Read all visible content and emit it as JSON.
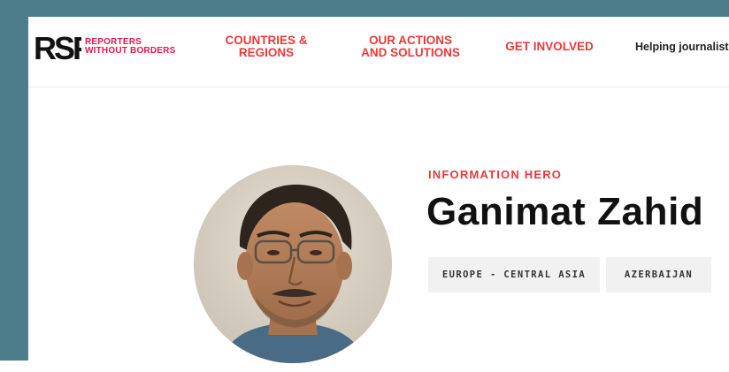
{
  "brand": {
    "mark": "RSF",
    "name_line1": "REPORTERS",
    "name_line2": "WITHOUT BORDERS",
    "color": "#e3174d"
  },
  "nav": {
    "countries": {
      "line1": "COUNTRIES &",
      "line2": "REGIONS"
    },
    "actions": {
      "line1": "OUR ACTIONS",
      "line2": "AND SOLUTIONS"
    },
    "involved": "GET INVOLVED",
    "helping": "Helping journalists",
    "accent_color": "#e8393b"
  },
  "profile": {
    "category": "INFORMATION HERO",
    "name": "Ganimat Zahid",
    "tags": [
      "EUROPE - CENTRAL ASIA",
      "AZERBAIJAN"
    ],
    "photo_icon": "portrait-photo"
  },
  "frame_color": "#4d7d8b"
}
